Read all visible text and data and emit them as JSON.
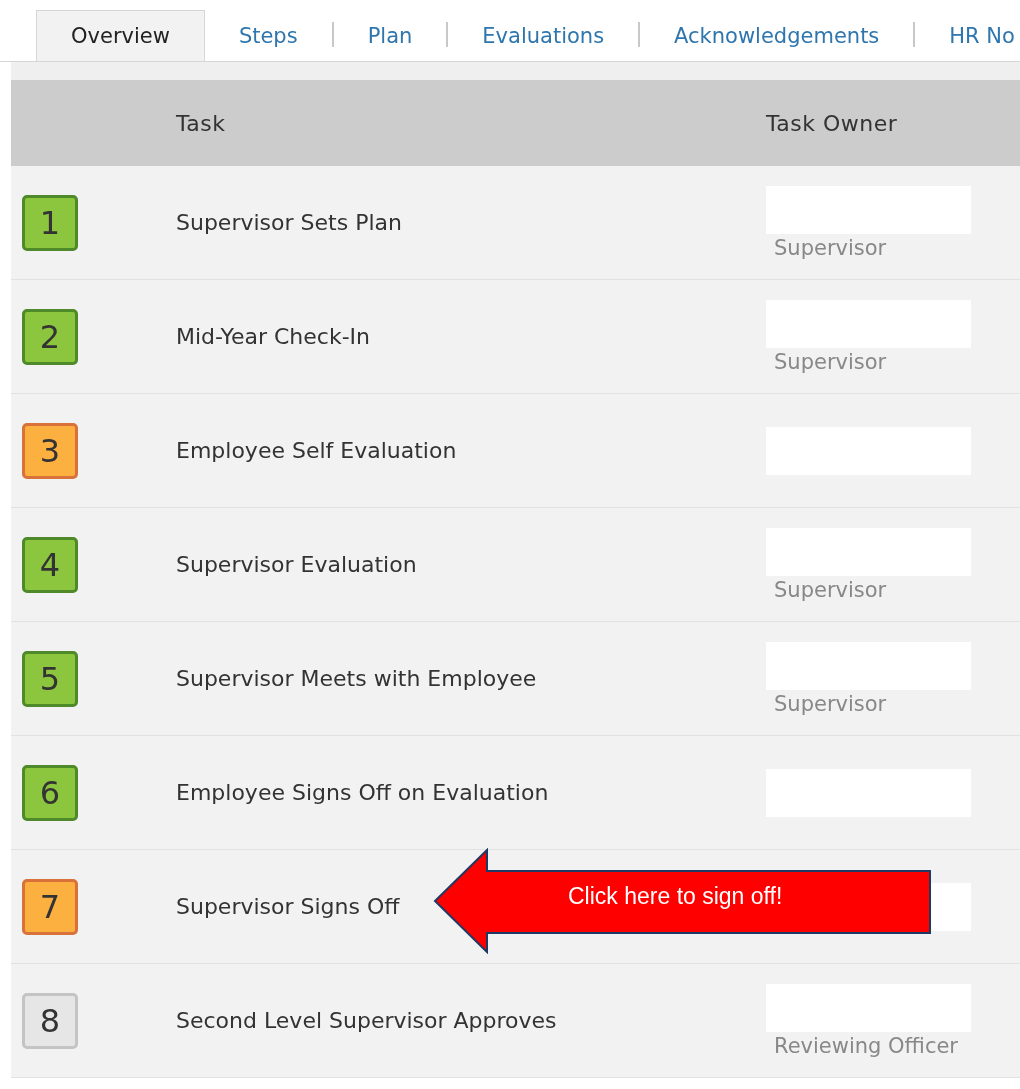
{
  "tabs": [
    {
      "label": "Overview",
      "selected": true
    },
    {
      "label": "Steps",
      "selected": false
    },
    {
      "label": "Plan",
      "selected": false
    },
    {
      "label": "Evaluations",
      "selected": false
    },
    {
      "label": "Acknowledgements",
      "selected": false
    },
    {
      "label": "HR No",
      "selected": false
    }
  ],
  "table": {
    "columns": [
      "Task",
      "Task Owner"
    ],
    "rows": [
      {
        "step": "1",
        "color": "#8cc63f",
        "task": "Supervisor Sets Plan",
        "role": "Supervisor"
      },
      {
        "step": "2",
        "color": "#8cc63f",
        "task": "Mid-Year Check-In",
        "role": "Supervisor"
      },
      {
        "step": "3",
        "color": "#fbb040",
        "task": "Employee Self Evaluation"
      },
      {
        "step": "4",
        "color": "#8cc63f",
        "task": "Supervisor Evaluation",
        "role": "Supervisor"
      },
      {
        "step": "5",
        "color": "#8cc63f",
        "task": "Supervisor Meets with Employee",
        "role": "Supervisor"
      },
      {
        "step": "6",
        "color": "#8cc63f",
        "task": "Employee Signs Off on Evaluation"
      },
      {
        "step": "7",
        "color": "#fbb040",
        "task": "Supervisor Signs Off",
        "callout": "Click here to sign off!"
      },
      {
        "step": "8",
        "color": "#e6e6e6",
        "task": "Second Level Supervisor Approves",
        "role": "Reviewing Officer"
      }
    ]
  }
}
